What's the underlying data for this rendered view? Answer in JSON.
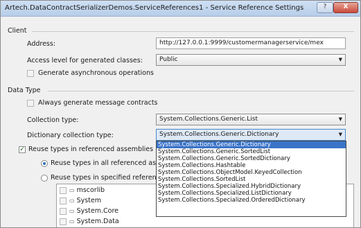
{
  "window": {
    "title": "Artech.DataContractSerializerDemos.ServiceReferences1 - Service Reference Settings",
    "help_button": "?",
    "close_button": "X"
  },
  "client": {
    "section_label": "Client",
    "address_label": "Address:",
    "address_value": "http://127.0.0.1:9999/customermanagerservice/mex",
    "access_label": "Access level for generated classes:",
    "access_value": "Public",
    "async_label": "Generate asynchronous operations"
  },
  "data_type": {
    "section_label": "Data Type",
    "message_contracts_label": "Always generate message contracts",
    "collection_label": "Collection type:",
    "collection_value": "System.Collections.Generic.List",
    "dictionary_label": "Dictionary collection type:",
    "dictionary_value": "System.Collections.Generic.Dictionary",
    "reuse_types_label": "Reuse types in referenced assemblies",
    "reuse_all_label": "Reuse types in all referenced assemb",
    "reuse_specified_label": "Reuse types in specified referenced a"
  },
  "assemblies": [
    {
      "name": "mscorlib",
      "checked": false
    },
    {
      "name": "System",
      "checked": false
    },
    {
      "name": "System.Core",
      "checked": false
    },
    {
      "name": "System.Data",
      "checked": false
    }
  ],
  "dictionary_options": [
    "System.Collections.Generic.Dictionary",
    "System.Collections.Generic.SortedList",
    "System.Collections.Generic.SortedDictionary",
    "System.Collections.Hashtable",
    "System.Collections.ObjectModel.KeyedCollection",
    "System.Collections.SortedList",
    "System.Collections.Specialized.HybridDictionary",
    "System.Collections.Specialized.ListDictionary",
    "System.Collections.Specialized.OrderedDictionary"
  ],
  "checks": {
    "reuse_types": "✓"
  },
  "icons": {
    "assembly": "▭",
    "dropdown_arrow": "▼"
  },
  "colors": {
    "selection": "#3a73c8",
    "titlebar": "#b7cde8"
  }
}
